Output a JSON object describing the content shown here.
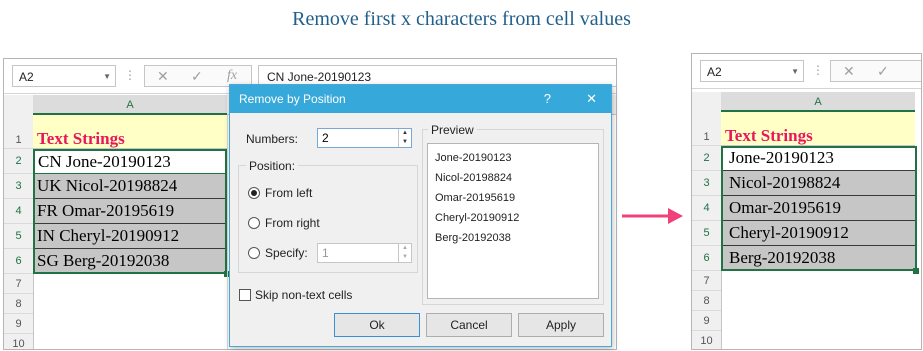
{
  "title": "Remove first x characters from cell values",
  "left_sheet": {
    "namebox": "A2",
    "formula": "CN Jone-20190123",
    "column": "A",
    "rows": [
      "1",
      "2",
      "3",
      "4",
      "5",
      "6",
      "7",
      "8",
      "9",
      "10"
    ],
    "header": "Text Strings",
    "values": [
      "CN Jone-20190123",
      "UK Nicol-20198824",
      "FR Omar-20195619",
      "IN Cheryl-20190912",
      "SG Berg-20192038"
    ]
  },
  "dialog": {
    "title": "Remove by Position",
    "help": "?",
    "close": "✕",
    "numbers_label": "Numbers:",
    "numbers_value": "2",
    "position_label": "Position:",
    "from_left": "From left",
    "from_right": "From right",
    "specify": "Specify:",
    "specify_value": "1",
    "preview_label": "Preview",
    "preview_items": [
      "Jone-20190123",
      "Nicol-20198824",
      "Omar-20195619",
      "Cheryl-20190912",
      "Berg-20192038"
    ],
    "skip_label": "Skip non-text cells",
    "ok": "Ok",
    "cancel": "Cancel",
    "apply": "Apply"
  },
  "right_sheet": {
    "namebox": "A2",
    "column": "A",
    "rows": [
      "1",
      "2",
      "3",
      "4",
      "5",
      "6",
      "7",
      "8",
      "9",
      "10"
    ],
    "header": "Text Strings",
    "values": [
      "Jone-20190123",
      "Nicol-20198824",
      "Omar-20195619",
      "Cheryl-20190912",
      "Berg-20192038"
    ]
  },
  "icons": {
    "cancel": "✕",
    "enter": "✓",
    "fx": "fx",
    "dots": "⋮"
  },
  "colors": {
    "accent": "#36a8d9",
    "header_text": "#e8175d",
    "arrow": "#f0427a",
    "title": "#1f5f8b",
    "excel_green": "#217346"
  }
}
